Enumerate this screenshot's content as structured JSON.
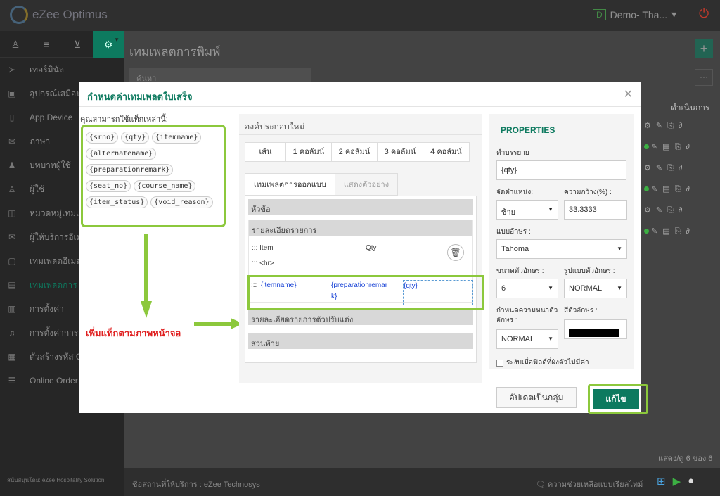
{
  "app": {
    "name": "eZee Optimus",
    "demo_badge": "D",
    "demo_label": "Demo- Tha...",
    "sponsor": "สนับสนุนโดย: eZee Hospitality Solution"
  },
  "sidebar": {
    "items": [
      {
        "label": "เทอร์มินัล",
        "icon": "terminal-icon"
      },
      {
        "label": "อุปกรณ์เสมือน",
        "icon": "device-icon"
      },
      {
        "label": "App Device",
        "icon": "tablet-icon"
      },
      {
        "label": "ภาษา",
        "icon": "language-icon"
      },
      {
        "label": "บทบาทผู้ใช้",
        "icon": "role-icon"
      },
      {
        "label": "ผู้ใช้",
        "icon": "user-icon"
      },
      {
        "label": "หมวดหมู่เทมเ",
        "icon": "category-icon"
      },
      {
        "label": "ผู้ให้บริการอีเม",
        "icon": "mail-icon"
      },
      {
        "label": "เทมเพลตอีเมล",
        "icon": "template-icon"
      },
      {
        "label": "เทมเพลตการ",
        "icon": "print-template-icon"
      },
      {
        "label": "การตั้งค่า",
        "icon": "settings-icon"
      },
      {
        "label": "การตั้งค่าการแ",
        "icon": "bell-icon"
      },
      {
        "label": "ตัวสร้างรหัส Q",
        "icon": "qr-icon"
      },
      {
        "label": "Online Order",
        "icon": "list-icon"
      }
    ]
  },
  "main": {
    "title": "เทมเพลตการพิมพ์",
    "search_placeholder": "ค้นหา",
    "actions_header": "ดำเนินการ",
    "paging": "แสดง/ดู 6 ของ 6"
  },
  "footer": {
    "provider": "ชื่อสถานที่ให้บริการ : eZee Technosys",
    "help": "ความช่วยเหลือแบบเรียลไทม์"
  },
  "modal": {
    "title": "กำหนดค่าเทมเพลตใบเสร็จ",
    "tags_label": "คุณสามารถใช้แท็กเหล่านี้:",
    "tags": [
      "{srno}",
      "{qty}",
      "{itemname}",
      "{alternatename}",
      "{preparationremark}",
      "{seat_no}",
      "{course_name}",
      "{item_status}",
      "{void_reason}"
    ],
    "annotation": "เพิ่มแท็กตามภาพหน้าจอ",
    "new_element": "องค์ประกอบใหม่",
    "columns": [
      "เส้น",
      "1 คอลัมน์",
      "2 คอลัมน์",
      "3 คอลัมน์",
      "4 คอลัมน์"
    ],
    "tab_design": "เทมเพลตการออกแบบ",
    "tab_preview": "แสดงตัวอย่าง",
    "sec_header": "หัวข้อ",
    "sec_detail": "รายละเอียดรายการ",
    "line1_a": "::: Item",
    "line1_b": "Qty",
    "line2": "::: <hr>",
    "row_handle": ":::",
    "row_c1": "{itemname}",
    "row_c2a": "{preparationremar",
    "row_c2b": "k}",
    "row_c3": "{qty}",
    "sec_modifier": "รายละเอียดรายการตัวปรับแต่ง",
    "sec_footer": "ส่วนท้าย",
    "props": {
      "title": "PROPERTIES",
      "desc_label": "คำบรรยาย",
      "desc_value": "{qty}",
      "align_label": "จัดตำแหน่ง:",
      "align_value": "ซ้าย",
      "width_label": "ความกว้าง(%) :",
      "width_value": "33.3333",
      "font_label": "แบบอักษร :",
      "font_value": "Tahoma",
      "size_label": "ขนาดตัวอักษร :",
      "size_value": "6",
      "style_label": "รูปแบบตัวอักษร :",
      "style_value": "NORMAL",
      "weight_label_a": "กำหนดความหนาตัว",
      "weight_label_b": "อักษร :",
      "weight_value": "NORMAL",
      "color_label": "สีตัวอักษร :",
      "color_value": "#000000",
      "suppress_label": "ระงับเมื่อฟิลด์ที่ผังตัวไม่มีค่า"
    },
    "btn_group": "อัปเดตเป็นกลุ่ม",
    "btn_save": "แก้ไข"
  }
}
